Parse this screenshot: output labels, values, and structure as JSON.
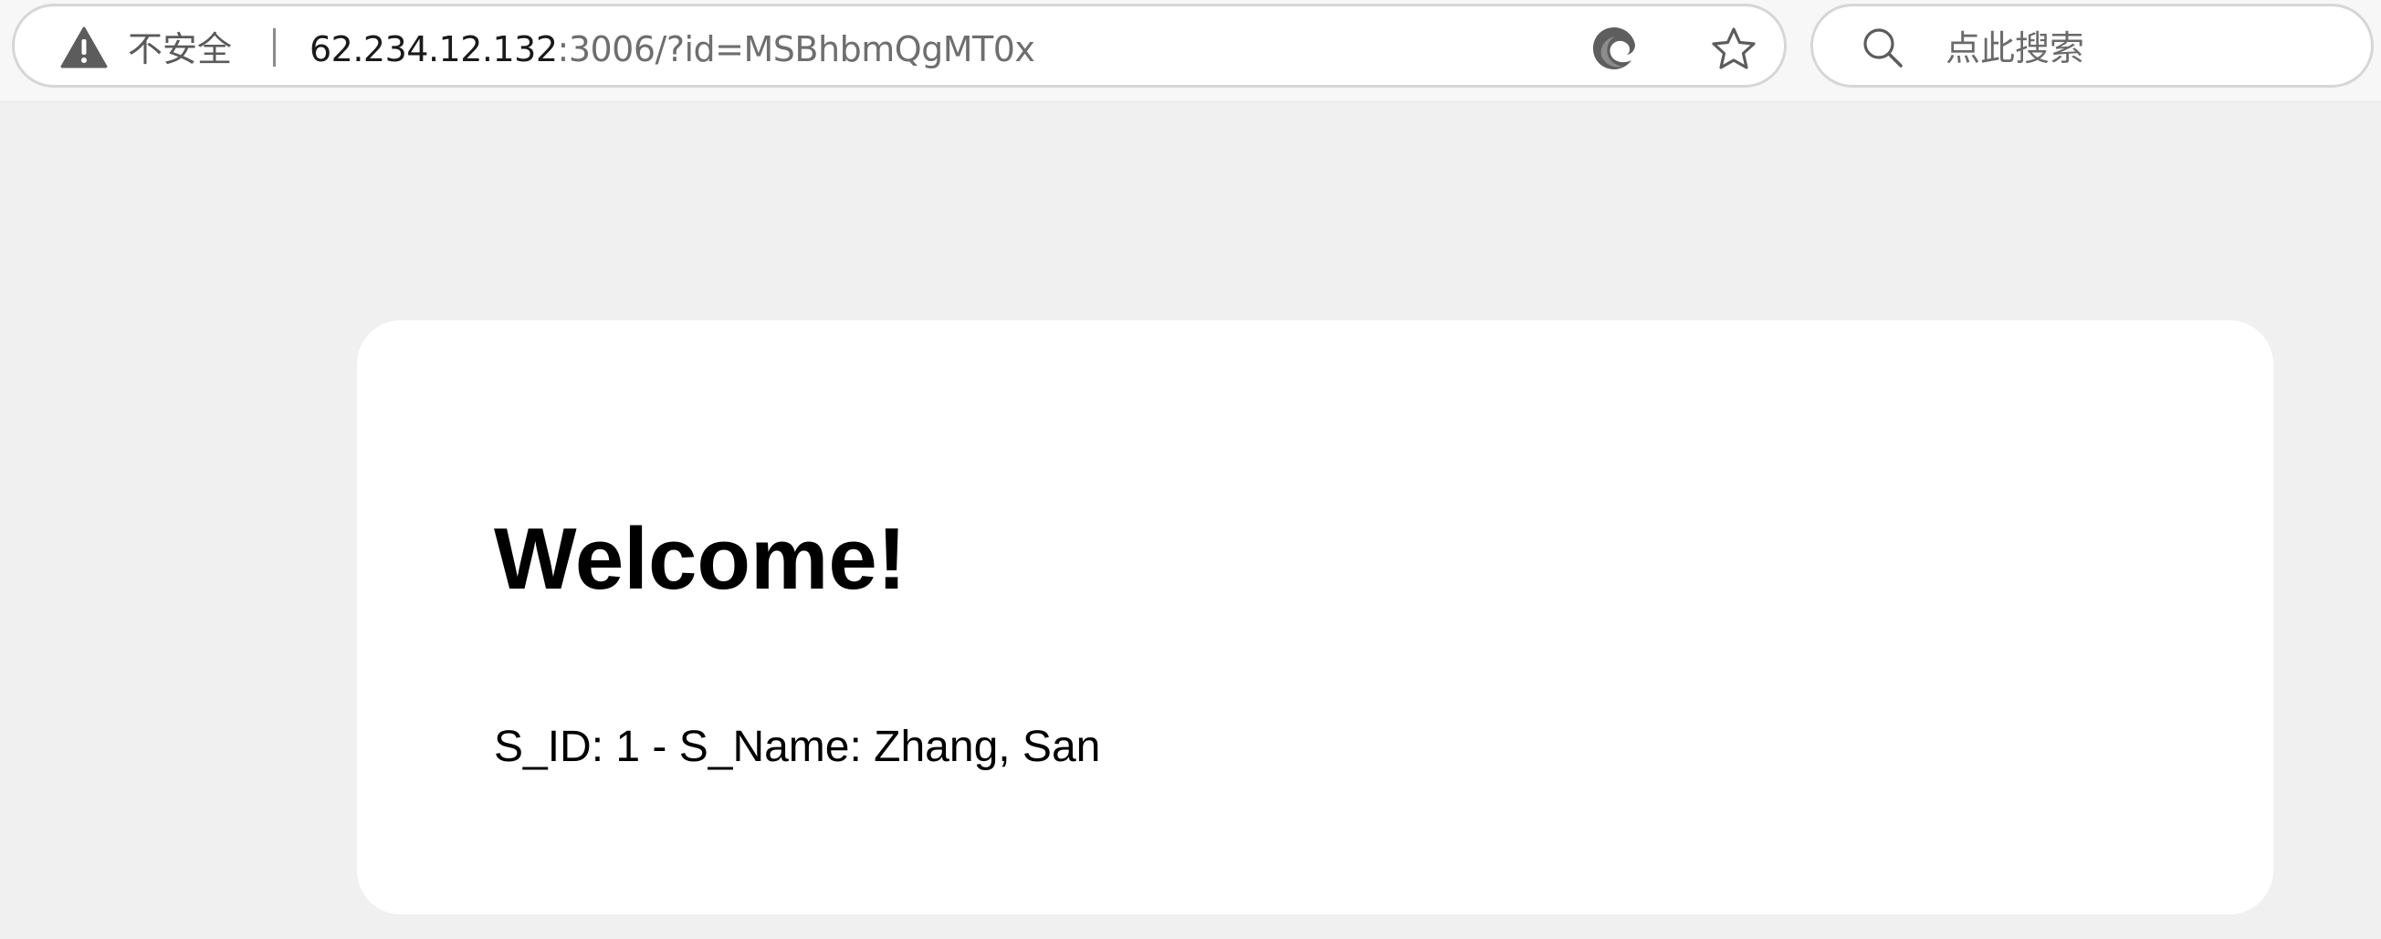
{
  "browser": {
    "security_label": "不安全",
    "url_host": "62.234.12.132",
    "url_rest": ":3006/?id=MSBhbmQgMT0x",
    "search_placeholder": "点此搜索",
    "icons": [
      "warning-icon",
      "edge-copilot-icon",
      "favorite-star-icon",
      "search-icon"
    ]
  },
  "page": {
    "heading": "Welcome!",
    "student_info": "S_ID: 1 - S_Name: Zhang, San"
  },
  "colors": {
    "page_background": "#f0f0f1",
    "card_background": "#ffffff",
    "text": "#000000",
    "url_muted": "#6e6e6e"
  }
}
